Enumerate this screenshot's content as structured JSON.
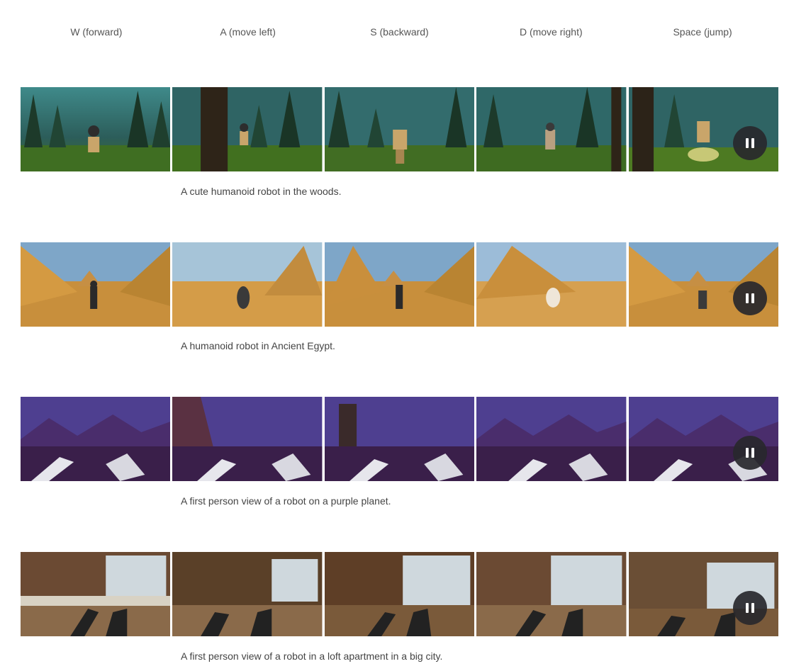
{
  "columns": [
    "W (forward)",
    "A (move left)",
    "S (backward)",
    "D (move right)",
    "Space (jump)"
  ],
  "rows": [
    {
      "scene": "forest",
      "caption": "A cute humanoid robot in the woods."
    },
    {
      "scene": "egypt",
      "caption": "A humanoid robot in Ancient Egypt."
    },
    {
      "scene": "purple",
      "caption": "A first person view of a robot on a purple planet."
    },
    {
      "scene": "loft",
      "caption": "A first person view of a robot in a loft apartment in a big city."
    }
  ],
  "colors": {
    "forest_sky": "#2f6a6e",
    "forest_ground": "#3d6a25",
    "egypt_sky": "#6f9fc8",
    "egypt_sand": "#c8913c",
    "purple_sky": "#4a3a8a",
    "purple_ground": "#3b1f4a",
    "loft_wall": "#6b4a33",
    "loft_window": "#cfd8dd"
  }
}
